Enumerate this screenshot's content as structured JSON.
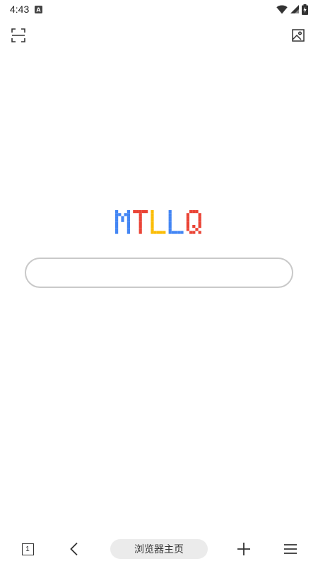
{
  "status_bar": {
    "time": "4:43",
    "notification_icon": "a-notification-icon",
    "wifi_icon": "wifi-icon",
    "signal_icon": "cell-signal-icon",
    "battery_icon": "battery-charging-icon"
  },
  "top_bar": {
    "scan_icon": "scan-icon",
    "image_icon": "image-icon"
  },
  "logo": {
    "letters": [
      "M",
      "T",
      "L",
      "L",
      "Q"
    ],
    "colors": [
      "#4285f4",
      "#ea4335",
      "#fbbc05",
      "#4285f4",
      "#ea4335"
    ]
  },
  "search": {
    "value": "",
    "placeholder": ""
  },
  "bottom_bar": {
    "tab_count": "1",
    "home_label": "浏览器主页",
    "back_icon": "back-chevron-icon",
    "add_icon": "plus-icon",
    "menu_icon": "menu-icon"
  }
}
